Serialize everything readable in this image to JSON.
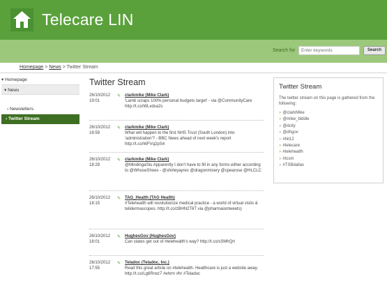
{
  "header": {
    "title": "Telecare LIN",
    "logo_icon": "house-icon"
  },
  "search": {
    "label": "Search for",
    "placeholder": "Enter keywords",
    "button": "Search"
  },
  "breadcrumb": {
    "home": "Homepage",
    "sep1": ">",
    "news": "News",
    "sep2": ">",
    "current": "Twitter Stream"
  },
  "sidebar": {
    "homepage": "Homepage",
    "news": "News",
    "newsletters": "Newsletters",
    "twitter_stream": "Twitter Stream"
  },
  "main": {
    "title": "Twitter Stream",
    "entries": [
      {
        "date": "26/10/2012",
        "time": "19:01",
        "author": "clarkmike (Mike Clark)",
        "text": "'Lamb scraps 100% personal budgets target' - via @CommunityCare http://t.co/WLxdxa2s"
      },
      {
        "date": "26/10/2012",
        "time": "18:59",
        "author": "clarkmike (Mike Clark)",
        "text": "What will happen to the first NHS Trust (South London) into 'administration'? - BBC News ahead of next week's report http://t.co/WFVq2pS4"
      },
      {
        "date": "26/10/2012",
        "time": "18:29",
        "author": "clarkmike (Mike Clark)",
        "text": "@MindingaStu Apparently I don't have to fill in any forms either according to @WhoseShoes - @shirleyayres @dragonmisery @cpearose @HLCLC"
      },
      {
        "date": "26/10/2012",
        "time": "18:15",
        "author": "TAG_Health (TAG Health)",
        "text": "#Telehealth will revolutionize medical practice - a world of virtual visits & telidermascopes. http://t.co/zBHN2T6T via @pharmaiontweets)"
      },
      {
        "date": "26/10/2012",
        "time": "18:01",
        "author": "HughesGov (HughesGov)",
        "text": "Can states get out of #telehealth's way? http://t.co/sSMhQrt"
      },
      {
        "date": "26/10/2012",
        "time": "17:55",
        "author": "Teladoc (Teladoc, Inc.)",
        "text": "Read this great article on #telehealth. Healthcare is just a website away. http://t.co/Lg6Rrwz7 #ehrm #hr #Teladoc"
      }
    ]
  },
  "panel": {
    "title": "Twitter Stream",
    "description": "The twitter stream on this page is gathered from the following:",
    "items": [
      "@clarkMike",
      "@mike_biddle",
      "@dcity",
      "@dhgov",
      "#hit12",
      "#telecare",
      "#telehealth",
      "#tcsm",
      "#TSBdallas"
    ]
  },
  "colors": {
    "header": "#5aa13c",
    "searchbar": "#9cc87b",
    "active_nav": "#3e6e22"
  }
}
